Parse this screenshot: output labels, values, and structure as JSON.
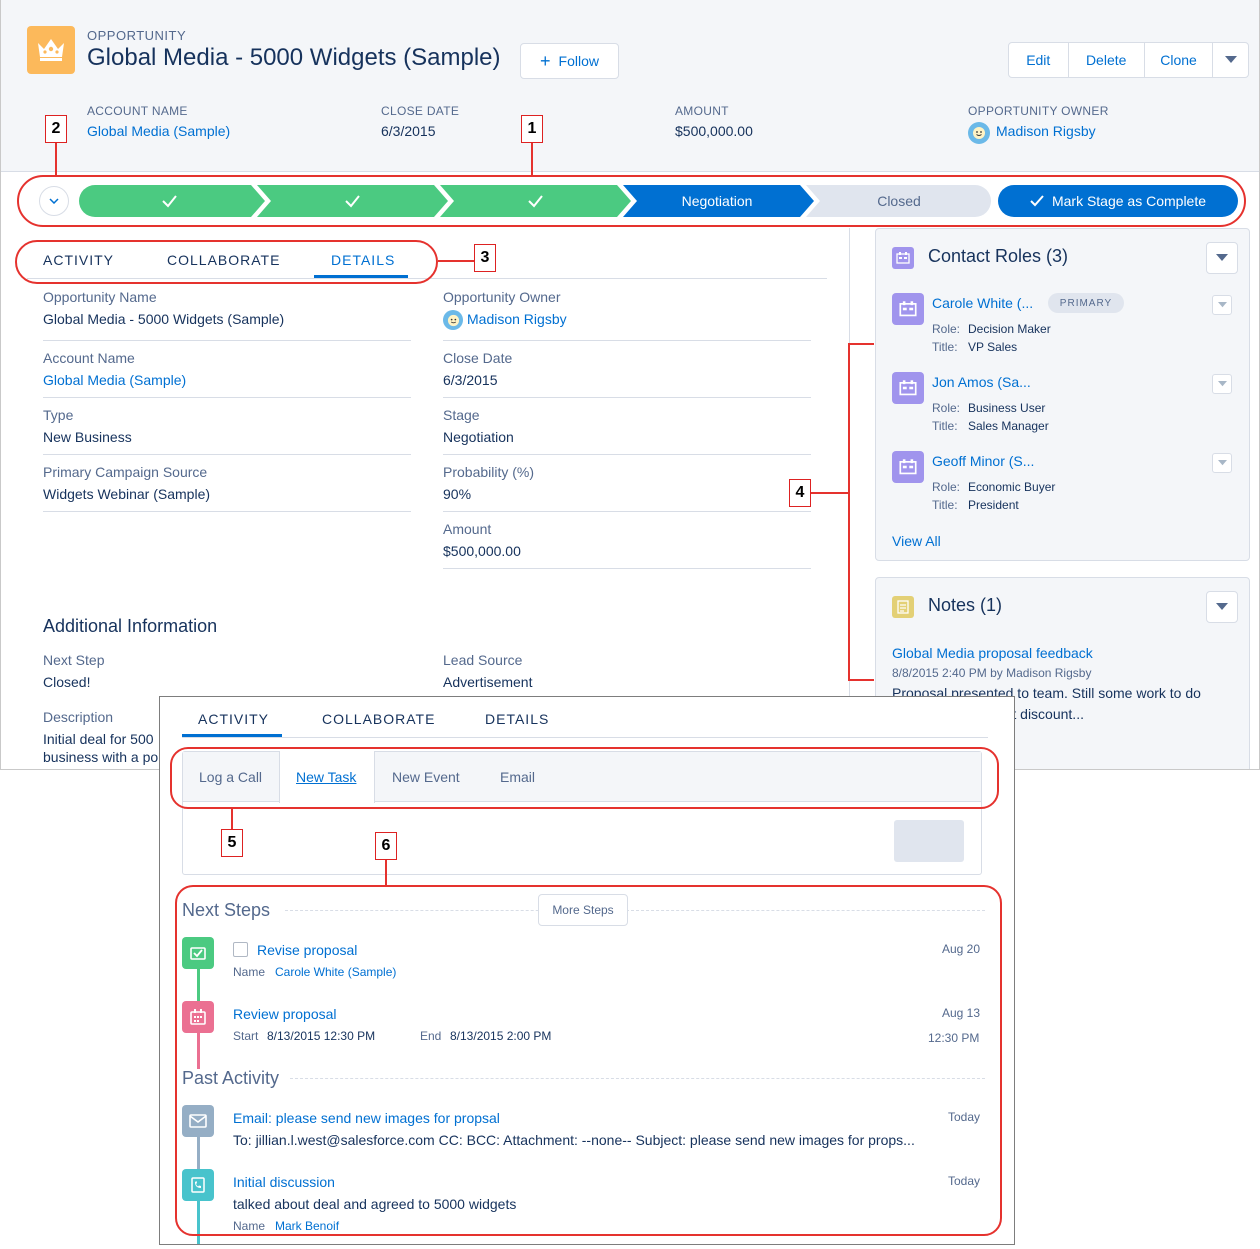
{
  "header": {
    "object_label": "OPPORTUNITY",
    "title": "Global Media - 5000 Widgets (Sample)",
    "follow_label": "Follow",
    "actions": {
      "edit": "Edit",
      "delete": "Delete",
      "clone": "Clone"
    },
    "highlights": [
      {
        "label": "ACCOUNT NAME",
        "value": "Global Media (Sample)",
        "is_link": true
      },
      {
        "label": "CLOSE DATE",
        "value": "6/3/2015",
        "is_link": false
      },
      {
        "label": "AMOUNT",
        "value": "$500,000.00",
        "is_link": false
      },
      {
        "label": "OPPORTUNITY OWNER",
        "value": "Madison Rigsby",
        "is_link": true
      }
    ]
  },
  "path": {
    "current_stage": "Negotiation",
    "next_stage": "Closed",
    "complete_button": "Mark Stage as Complete"
  },
  "tabs": {
    "activity": "ACTIVITY",
    "collaborate": "COLLABORATE",
    "details": "DETAILS",
    "active": "DETAILS"
  },
  "details": {
    "left": [
      {
        "label": "Opportunity Name",
        "value": "Global Media - 5000 Widgets (Sample)"
      },
      {
        "label": "Account Name",
        "value": "Global Media (Sample)"
      },
      {
        "label": "Type",
        "value": "New Business"
      },
      {
        "label": "Primary Campaign Source",
        "value": "Widgets Webinar (Sample)"
      }
    ],
    "right": [
      {
        "label": "Opportunity Owner",
        "value": "Madison Rigsby"
      },
      {
        "label": "Close Date",
        "value": "6/3/2015"
      },
      {
        "label": "Stage",
        "value": "Negotiation"
      },
      {
        "label": "Probability (%)",
        "value": "90%"
      },
      {
        "label": "Amount",
        "value": "$500,000.00"
      }
    ],
    "additional_title": "Additional Information",
    "next_step_label": "Next Step",
    "next_step_value": "Closed!",
    "lead_source_label": "Lead Source",
    "lead_source_value": "Advertisement",
    "description_label": "Description",
    "description_line1": "Initial deal for 500",
    "description_line2": "business with a po"
  },
  "contact_roles": {
    "title": "Contact Roles (3)",
    "primary_badge": "PRIMARY",
    "role_label": "Role:",
    "title_label": "Title:",
    "items": [
      {
        "name": "Carole White (...",
        "role": "Decision Maker",
        "title": "VP Sales"
      },
      {
        "name": "Jon Amos (Sa...",
        "role": "Business User",
        "title": "Sales Manager"
      },
      {
        "name": "Geoff Minor (S...",
        "role": "Economic Buyer",
        "title": "President"
      }
    ],
    "view_all": "View All"
  },
  "notes": {
    "title": "Notes (1)",
    "note_title": "Global Media proposal feedback",
    "note_meta": "8/8/2015 2:40 PM by Madison Rigsby",
    "note_line1": "Proposal presented to team.  Still some work to do",
    "note_line2": "g. Talk to Don about discount..."
  },
  "activity_panel": {
    "tabs": {
      "activity": "ACTIVITY",
      "collaborate": "COLLABORATE",
      "details": "DETAILS"
    },
    "publisher_tabs": [
      "Log a Call",
      "New Task",
      "New Event",
      "Email"
    ],
    "active_publisher": "New Task",
    "next_steps_title": "Next Steps",
    "more_steps": "More Steps",
    "past_activity_title": "Past Activity",
    "task": {
      "title": "Revise proposal",
      "name_label": "Name",
      "name_value": "Carole White (Sample)",
      "date": "Aug 20"
    },
    "event": {
      "title": "Review proposal",
      "start_label": "Start",
      "start_value": "8/13/2015 12:30 PM",
      "end_label": "End",
      "end_value": "8/13/2015 2:00 PM",
      "date": "Aug 13",
      "time": "12:30 PM"
    },
    "email": {
      "title": "Email: please send new images for propsal",
      "body": "To: jillian.l.west@salesforce.com CC: BCC: Attachment: --none-- Subject: please send new images for props...",
      "date": "Today"
    },
    "call": {
      "title": "Initial discussion",
      "body": "talked about deal and agreed to 5000 widgets",
      "name_label": "Name",
      "name_value": "Mark Benoif",
      "date": "Today"
    }
  },
  "callouts": [
    "1",
    "2",
    "3",
    "4",
    "5",
    "6"
  ],
  "colors": {
    "complete": "#4bca81",
    "current": "#0070d2",
    "incomplete": "#e0e5ee",
    "brand": "#0070d2",
    "annotation": "#e5322e"
  }
}
